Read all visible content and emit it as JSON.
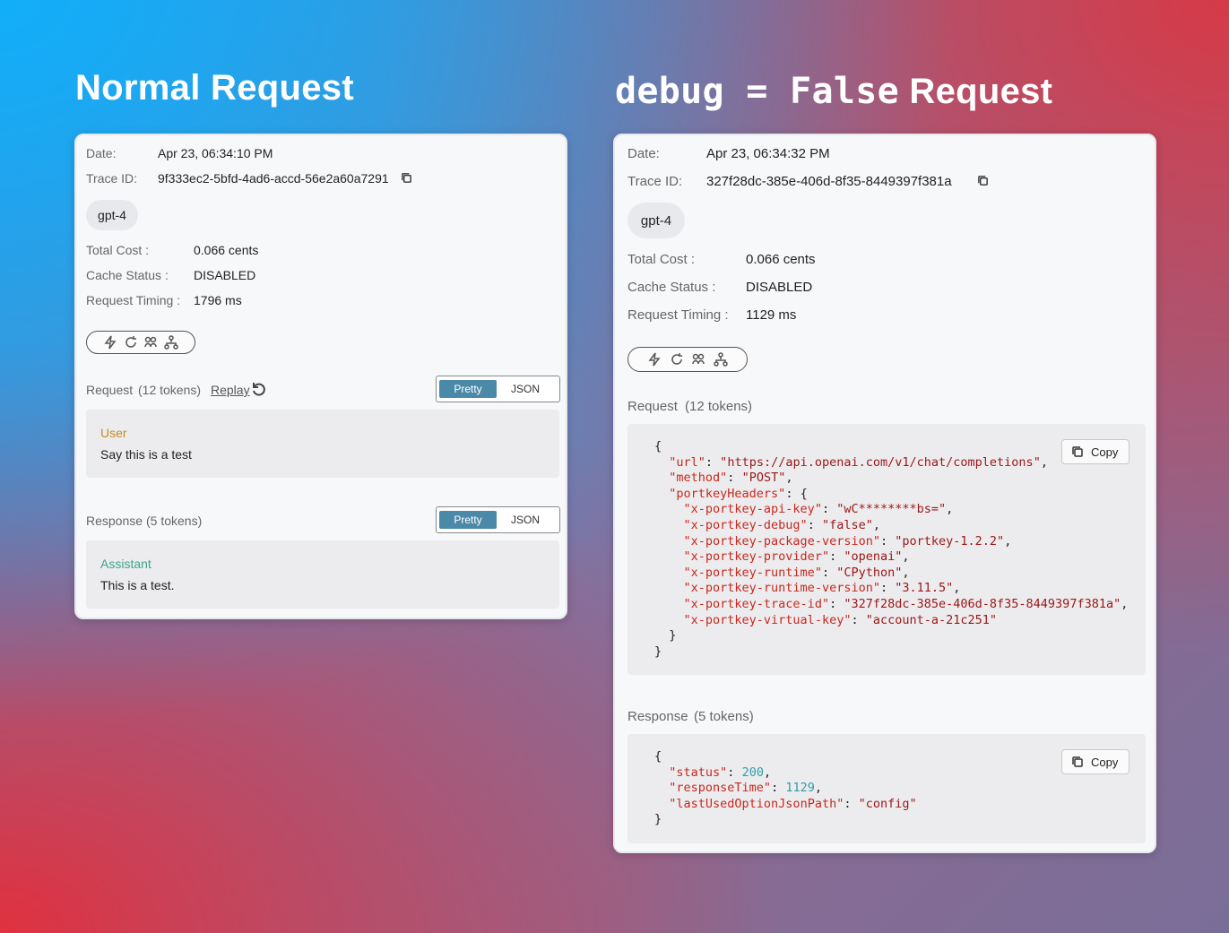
{
  "headings": {
    "left": "Normal Request",
    "right_code": "debug = False",
    "right_suffix": " Request"
  },
  "left": {
    "date_label": "Date:",
    "date_value": "Apr 23, 06:34:10 PM",
    "trace_label": "Trace ID:",
    "trace_value": "9f333ec2-5bfd-4ad6-accd-56e2a60a7291",
    "model": "gpt-4",
    "cost_label": "Total Cost :",
    "cost_value": "0.066 cents",
    "cache_label": "Cache Status :",
    "cache_value": "DISABLED",
    "timing_label": "Request Timing :",
    "timing_value": "1796 ms",
    "request_label": "Request",
    "request_tokens": "(12 tokens)",
    "replay": "Replay",
    "pretty": "Pretty",
    "json": "JSON",
    "user_role": "User",
    "user_text": "Say this is a test",
    "response_label": "Response",
    "response_tokens": "(5 tokens)",
    "assistant_role": "Assistant",
    "assistant_text": "This is a test."
  },
  "right": {
    "date_label": "Date:",
    "date_value": "Apr 23, 06:34:32 PM",
    "trace_label": "Trace ID:",
    "trace_value": "327f28dc-385e-406d-8f35-8449397f381a",
    "model": "gpt-4",
    "cost_label": "Total Cost :",
    "cost_value": "0.066 cents",
    "cache_label": "Cache Status :",
    "cache_value": "DISABLED",
    "timing_label": "Request Timing :",
    "timing_value": "1129 ms",
    "request_label": "Request",
    "request_tokens": "(12 tokens)",
    "response_label": "Response",
    "response_tokens": "(5 tokens)",
    "copy": "Copy",
    "request_json": {
      "url": "https://api.openai.com/v1/chat/completions",
      "method": "POST",
      "portkeyHeaders": {
        "x-portkey-api-key": "wC********bs=",
        "x-portkey-debug": "false",
        "x-portkey-package-version": "portkey-1.2.2",
        "x-portkey-provider": "openai",
        "x-portkey-runtime": "CPython",
        "x-portkey-runtime-version": "3.11.5",
        "x-portkey-trace-id": "327f28dc-385e-406d-8f35-8449397f381a",
        "x-portkey-virtual-key": "account-a-21c251"
      }
    },
    "response_json": {
      "status": 200,
      "responseTime": 1129,
      "lastUsedOptionJsonPath": "config"
    }
  },
  "icons": [
    "bolt-icon",
    "refresh-icon",
    "feedback-icon",
    "tree-icon",
    "copy-icon",
    "replay-icon"
  ],
  "colors": {
    "toggle_active": "#4b89a8",
    "user_role": "#c68a22",
    "assistant_role": "#3aa58a",
    "json_key": "#c8281e",
    "json_string": "#9c1616",
    "json_number": "#2c9da8"
  }
}
